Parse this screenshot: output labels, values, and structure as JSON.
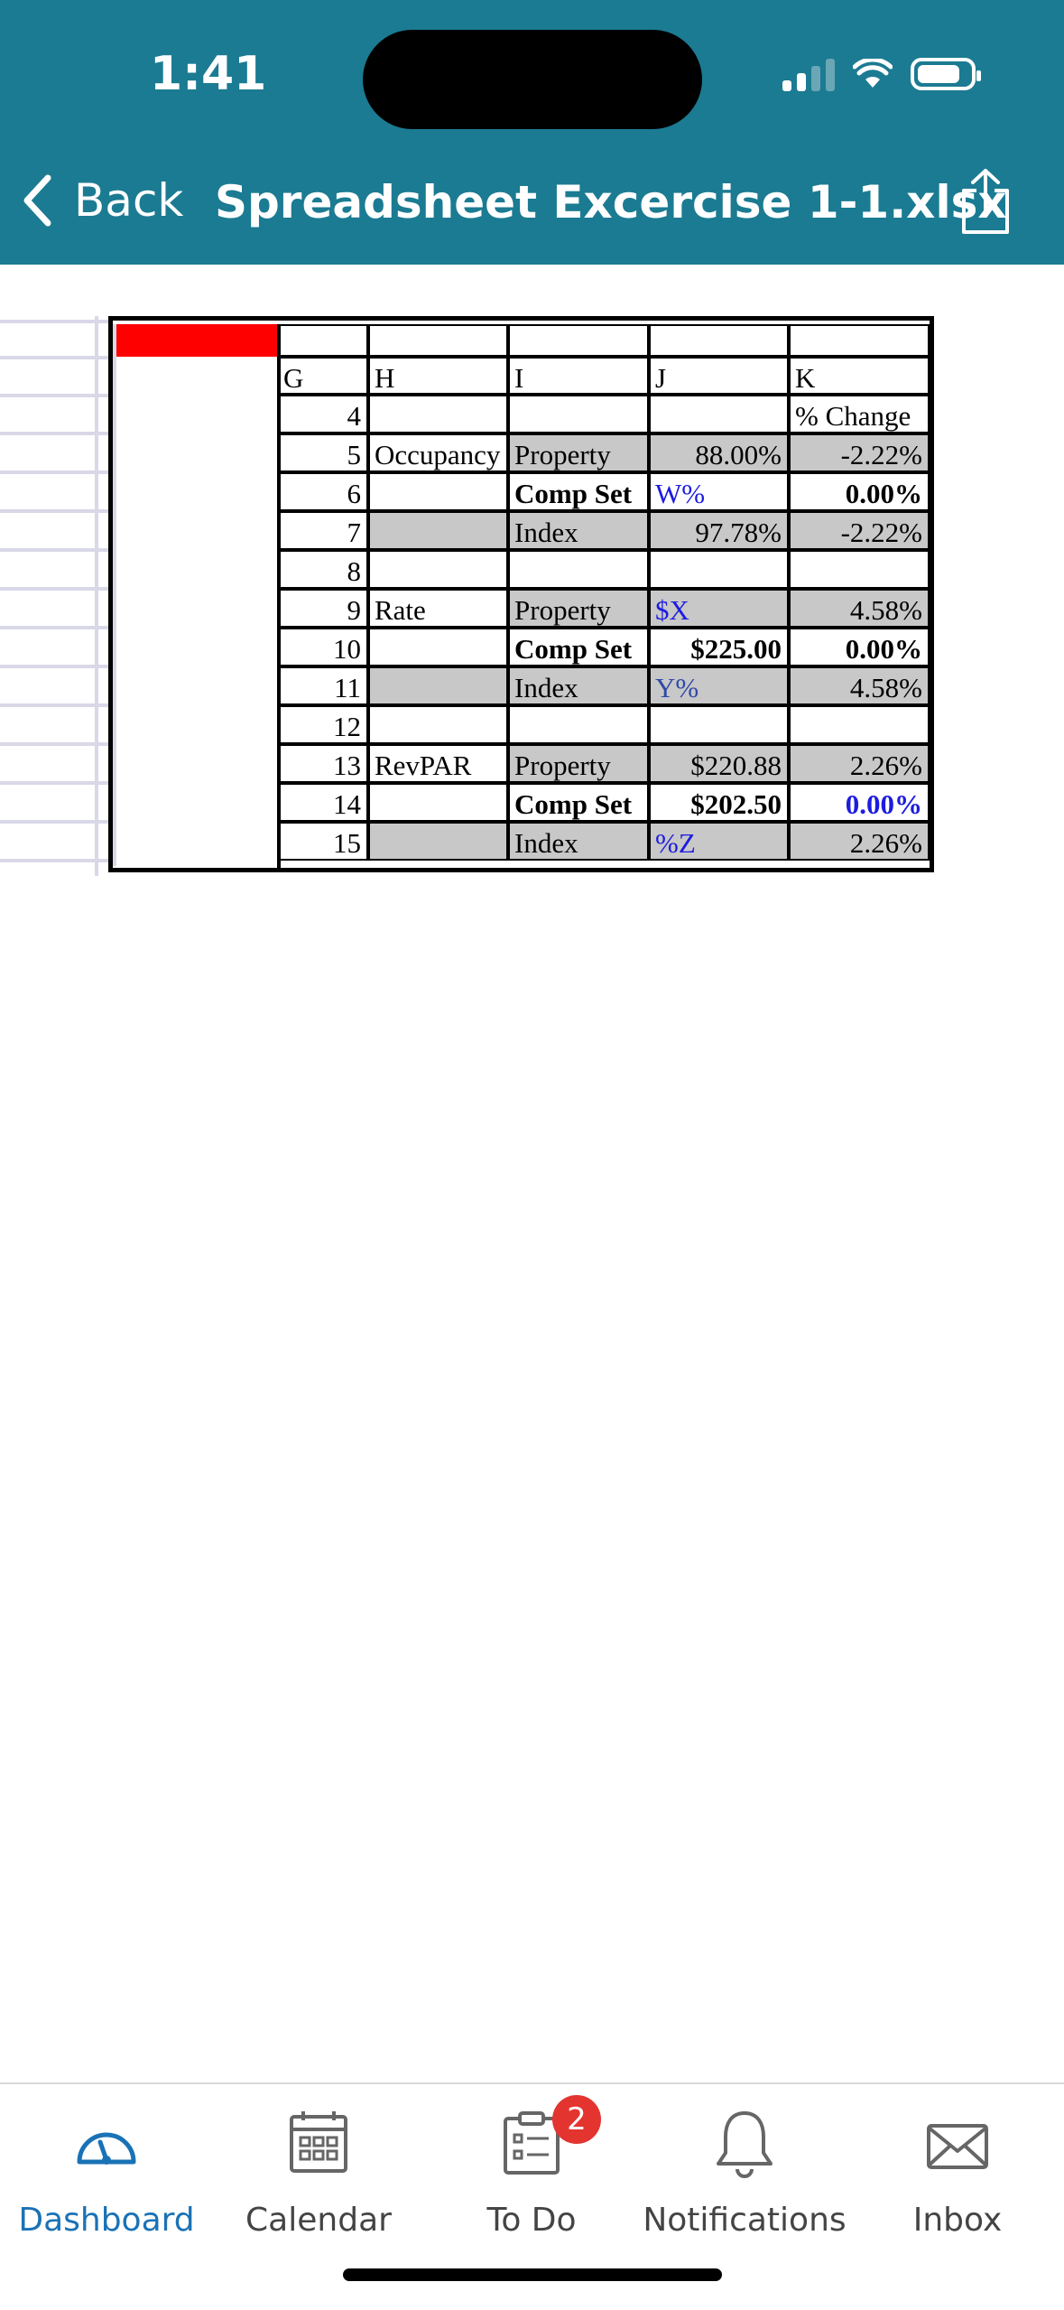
{
  "status_bar": {
    "time": "1:41"
  },
  "nav": {
    "back_label": "Back",
    "title": "Spreadsheet Excercise 1-1.xlsx"
  },
  "sheet": {
    "col_headers": [
      "G",
      "H",
      "I",
      "J",
      "K"
    ],
    "k_header": "% Change",
    "rows": [
      {
        "n": "4",
        "h": "",
        "i": "",
        "j": "",
        "k": ""
      },
      {
        "n": "5",
        "h": "Occupancy",
        "i": "Property",
        "j": "88.00%",
        "k": "-2.22%"
      },
      {
        "n": "6",
        "h": "",
        "i": "Comp Set",
        "j": "W%",
        "k": "0.00%"
      },
      {
        "n": "7",
        "h": "",
        "i": "Index",
        "j": "97.78%",
        "k": "-2.22%"
      },
      {
        "n": "8",
        "h": "",
        "i": "",
        "j": "",
        "k": ""
      },
      {
        "n": "9",
        "h": "Rate",
        "i": "Property",
        "j": "$X",
        "k": "4.58%"
      },
      {
        "n": "10",
        "h": "",
        "i": "Comp Set",
        "j": "$225.00",
        "k": "0.00%"
      },
      {
        "n": "11",
        "h": "",
        "i": "Index",
        "j": "Y%",
        "k": "4.58%"
      },
      {
        "n": "12",
        "h": "",
        "i": "",
        "j": "",
        "k": ""
      },
      {
        "n": "13",
        "h": "RevPAR",
        "i": "Property",
        "j": "$220.88",
        "k": "2.26%"
      },
      {
        "n": "14",
        "h": "",
        "i": "Comp Set",
        "j": "$202.50",
        "k": "0.00%"
      },
      {
        "n": "15",
        "h": "",
        "i": "Index",
        "j": "%Z",
        "k": "2.26%"
      }
    ]
  },
  "tabbar": {
    "items": [
      {
        "label": "Dashboard",
        "icon": "dashboard-icon",
        "active": true
      },
      {
        "label": "Calendar",
        "icon": "calendar-icon"
      },
      {
        "label": "To Do",
        "icon": "todo-icon",
        "badge": "2"
      },
      {
        "label": "Notifications",
        "icon": "bell-icon"
      },
      {
        "label": "Inbox",
        "icon": "envelope-icon"
      }
    ]
  },
  "colors": {
    "header": "#1b7b92",
    "active_tab": "#1a72b6",
    "badge": "#e3342f",
    "cell_gray": "#c8c8c8",
    "highlight_red": "#ff0000",
    "blue_text": "#1c1ce0"
  }
}
